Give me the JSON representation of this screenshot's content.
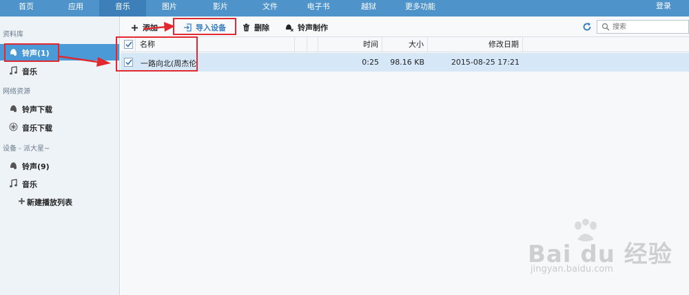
{
  "nav": {
    "tabs": [
      "首页",
      "应用",
      "音乐",
      "图片",
      "影片",
      "文件",
      "电子书",
      "越狱",
      "更多功能"
    ],
    "active": "音乐",
    "login": "登录"
  },
  "sidebar": {
    "library_title": "资料库",
    "library_items": [
      "铃声(1)",
      "音乐"
    ],
    "network_title": "网络资源",
    "network_items": [
      "铃声下载",
      "音乐下载"
    ],
    "device_title": "设备 - 派大星~",
    "device_items": [
      "铃声(9)",
      "音乐"
    ],
    "new_playlist": "新建播放列表"
  },
  "toolbar": {
    "add": "添加",
    "import": "导入设备",
    "delete": "删除",
    "ringtone_make": "铃声制作",
    "search_placeholder": "搜索"
  },
  "table": {
    "headers": {
      "name": "名称",
      "time": "时间",
      "size": "大小",
      "modified": "修改日期"
    },
    "rows": [
      {
        "name": "一路向北(周杰伦",
        "time": "0:25",
        "size": "98.16 KB",
        "modified": "2015-08-25 17:21"
      }
    ]
  },
  "watermark": {
    "brand": "Bai du 经验",
    "url": "jingyan.baidu.com"
  },
  "colors": {
    "nav": "#4f93cb",
    "nav_active": "#3d7fb8",
    "sidebar_active": "#4a9ad8",
    "row_selected": "#d6e7f8",
    "annotation": "#e0282e"
  }
}
